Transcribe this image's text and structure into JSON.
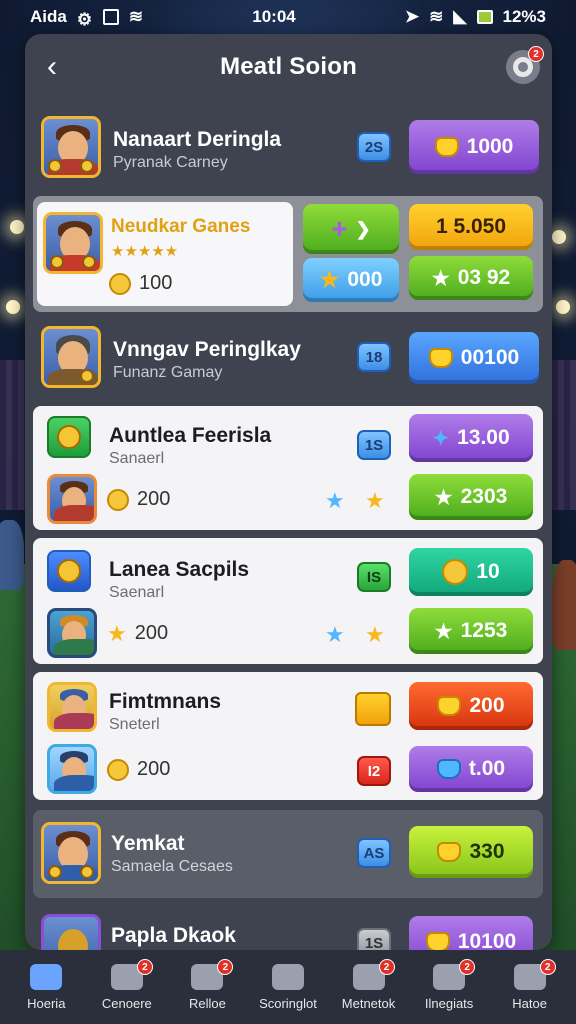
{
  "status_bar": {
    "left_text": "Aida",
    "time": "10:04",
    "right_text": "12%3"
  },
  "header": {
    "title": "Meatl Soion",
    "back_icon": "chevron-left-icon",
    "settings_badge": "2"
  },
  "rows": [
    {
      "name": "Nanaart Deringla",
      "sub": "Pyranak Carney",
      "level": "2S",
      "pill_value": "1000",
      "pill_color": "#8b4fd6"
    },
    {
      "name": "Neudkar Ganes",
      "sub_rating": "★★★★★",
      "stat_value": "100",
      "btn1_value": "+",
      "btn2_value": "000",
      "btn3_value": "1 5.050",
      "btn4_value": "03 92"
    },
    {
      "name": "Vnngav Peringlkay",
      "sub": "Funanz Gamay",
      "level": "18",
      "pill_value": "00100"
    },
    {
      "name": "Auntlea Feerisla",
      "sub": "Sanaerl",
      "level": "1S",
      "pill_value": "13.00",
      "stat_value": "200",
      "pill2_value": "2303"
    },
    {
      "name": "Lanea Sacpils",
      "sub": "Saenarl",
      "level": "IS",
      "pill_value": "10",
      "stat_value": "200",
      "pill2_value": "1253"
    },
    {
      "name": "Fimtmnans",
      "sub": "Sneterl",
      "level": "",
      "pill_value": "200",
      "stat_value": "200",
      "level2": "I2",
      "pill2_value": "t.00"
    },
    {
      "name": "Yemkat",
      "sub": "Samaela Cesaes",
      "level": "AS",
      "pill_value": "330"
    },
    {
      "name": "Papla Dkaok",
      "level": "1S",
      "pill_value": "10100"
    }
  ],
  "bottom_nav": [
    {
      "label": "Hoeria",
      "icon": "home-icon",
      "badge": ""
    },
    {
      "label": "Cenoere",
      "icon": "check-shield-icon",
      "badge": "2"
    },
    {
      "label": "Relloe",
      "icon": "player-icon",
      "badge": "2"
    },
    {
      "label": "Scoringlot",
      "icon": "smile-icon",
      "badge": ""
    },
    {
      "label": "Metnetok",
      "icon": "check-badge-icon",
      "badge": "2"
    },
    {
      "label": "Ilnegiats",
      "icon": "tools-icon",
      "badge": "2"
    },
    {
      "label": "Hatoe",
      "icon": "profile-icon",
      "badge": "2"
    }
  ]
}
